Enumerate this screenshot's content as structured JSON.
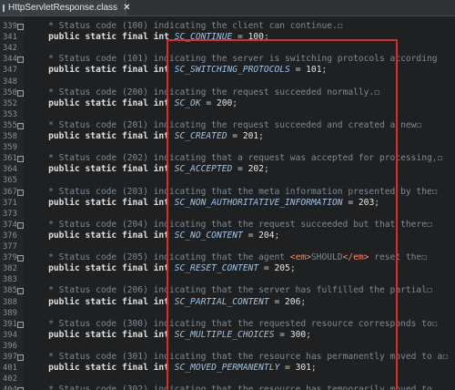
{
  "tab": {
    "label": "HttpServletResponse.class",
    "close": "✕",
    "icon": "class-file-icon"
  },
  "lines": [
    {
      "n": "339",
      "fold": true,
      "comment": "    * Status code (100) indicating the client can continue.",
      "tail": "☐"
    },
    {
      "n": "341",
      "fold": false,
      "decl": "SC_CONTINUE",
      "value": "100"
    },
    {
      "n": "342",
      "fold": false
    },
    {
      "n": "344",
      "fold": true,
      "comment": "    * Status code (101) indicating the server is switching protocols according"
    },
    {
      "n": "347",
      "fold": false,
      "decl": "SC_SWITCHING_PROTOCOLS",
      "value": "101"
    },
    {
      "n": "348",
      "fold": false
    },
    {
      "n": "350",
      "fold": true,
      "comment": "    * Status code (200) indicating the request succeeded normally.",
      "tail": "☐"
    },
    {
      "n": "352",
      "fold": false,
      "decl": "SC_OK",
      "value": "200"
    },
    {
      "n": "353",
      "fold": false
    },
    {
      "n": "355",
      "fold": true,
      "comment": "    * Status code (201) indicating the request succeeded and created a new",
      "tail": "☐"
    },
    {
      "n": "358",
      "fold": false,
      "decl": "SC_CREATED",
      "value": "201"
    },
    {
      "n": "359",
      "fold": false
    },
    {
      "n": "361",
      "fold": true,
      "comment": "    * Status code (202) indicating that a request was accepted for processing,",
      "tail": "☐"
    },
    {
      "n": "364",
      "fold": false,
      "decl": "SC_ACCEPTED",
      "value": "202"
    },
    {
      "n": "365",
      "fold": false
    },
    {
      "n": "367",
      "fold": true,
      "comment": "    * Status code (203) indicating that the meta information presented by the",
      "tail": "☐"
    },
    {
      "n": "371",
      "fold": false,
      "decl": "SC_NON_AUTHORITATIVE_INFORMATION",
      "value": "203"
    },
    {
      "n": "373",
      "fold": false
    },
    {
      "n": "374",
      "fold": true,
      "comment": "    * Status code (204) indicating that the request succeeded but that there",
      "tail": "☐"
    },
    {
      "n": "376",
      "fold": false,
      "decl": "SC_NO_CONTENT",
      "value": "204"
    },
    {
      "n": "377",
      "fold": false
    },
    {
      "n": "379",
      "fold": true,
      "comment": "    * Status code (205) indicating that the agent ",
      "tagopen": "<em>",
      "em": "SHOULD",
      "tagclose": "</em>",
      "after": " reset the",
      "tail": "☐"
    },
    {
      "n": "382",
      "fold": false,
      "decl": "SC_RESET_CONTENT",
      "value": "205"
    },
    {
      "n": "383",
      "fold": false
    },
    {
      "n": "385",
      "fold": true,
      "comment": "    * Status code (206) indicating that the server has fulfilled the partial",
      "tail": "☐"
    },
    {
      "n": "388",
      "fold": false,
      "decl": "SC_PARTIAL_CONTENT",
      "value": "206"
    },
    {
      "n": "389",
      "fold": false
    },
    {
      "n": "391",
      "fold": true,
      "comment": "    * Status code (300) indicating that the requested resource corresponds to",
      "tail": "☐"
    },
    {
      "n": "394",
      "fold": false,
      "decl": "SC_MULTIPLE_CHOICES",
      "value": "300"
    },
    {
      "n": "396",
      "fold": false
    },
    {
      "n": "397",
      "fold": true,
      "comment": "    * Status code (301) indicating that the resource has permanently moved to a",
      "tail": "☐"
    },
    {
      "n": "401",
      "fold": false,
      "decl": "SC_MOVED_PERMANENTLY",
      "value": "301"
    },
    {
      "n": "402",
      "fold": false
    },
    {
      "n": "404",
      "fold": true,
      "comment": "    * Status code (302) indicating that the resource has temporarily moved to"
    }
  ],
  "decl_prefix": "public static final int",
  "colors": {
    "highlight": "#e02a2a",
    "background": "#1e2022",
    "comment": "#7e8a94",
    "constant": "#9fc3e8"
  }
}
